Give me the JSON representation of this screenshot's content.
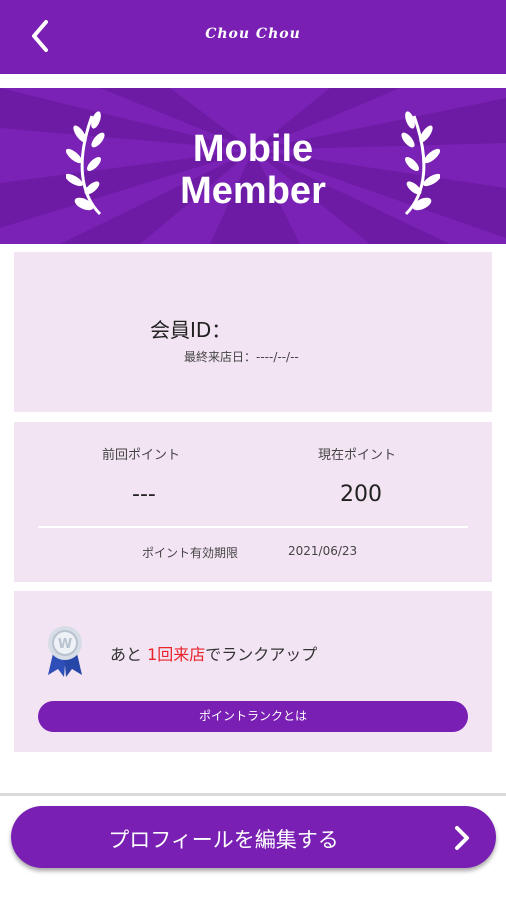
{
  "header": {
    "title": "Chou  Chou",
    "back_icon": "chevron-left-icon"
  },
  "banner": {
    "title_line1": "Mobile",
    "title_line2": "Member",
    "icon": "laurel-icon"
  },
  "member": {
    "id_label": "会員ID：",
    "last_visit_label": "最終来店日：----/--/--"
  },
  "points": {
    "previous_label": "前回ポイント",
    "previous_value": "---",
    "current_label": "現在ポイント",
    "current_value": "200",
    "expiry_label": "ポイント有効期限",
    "expiry_value": "2021/06/23"
  },
  "rank": {
    "text_prefix": "あと ",
    "text_highlight": "1回来店",
    "text_suffix": "でランクアップ",
    "button_label": "ポイントランクとは",
    "icon": "rank-ribbon-icon"
  },
  "footer": {
    "edit_button_label": "プロフィールを編集する",
    "edit_icon": "chevron-right-icon"
  },
  "colors": {
    "primary": "#7a1fb4",
    "card_bg": "#f3e4f3",
    "highlight": "#e8232a"
  }
}
